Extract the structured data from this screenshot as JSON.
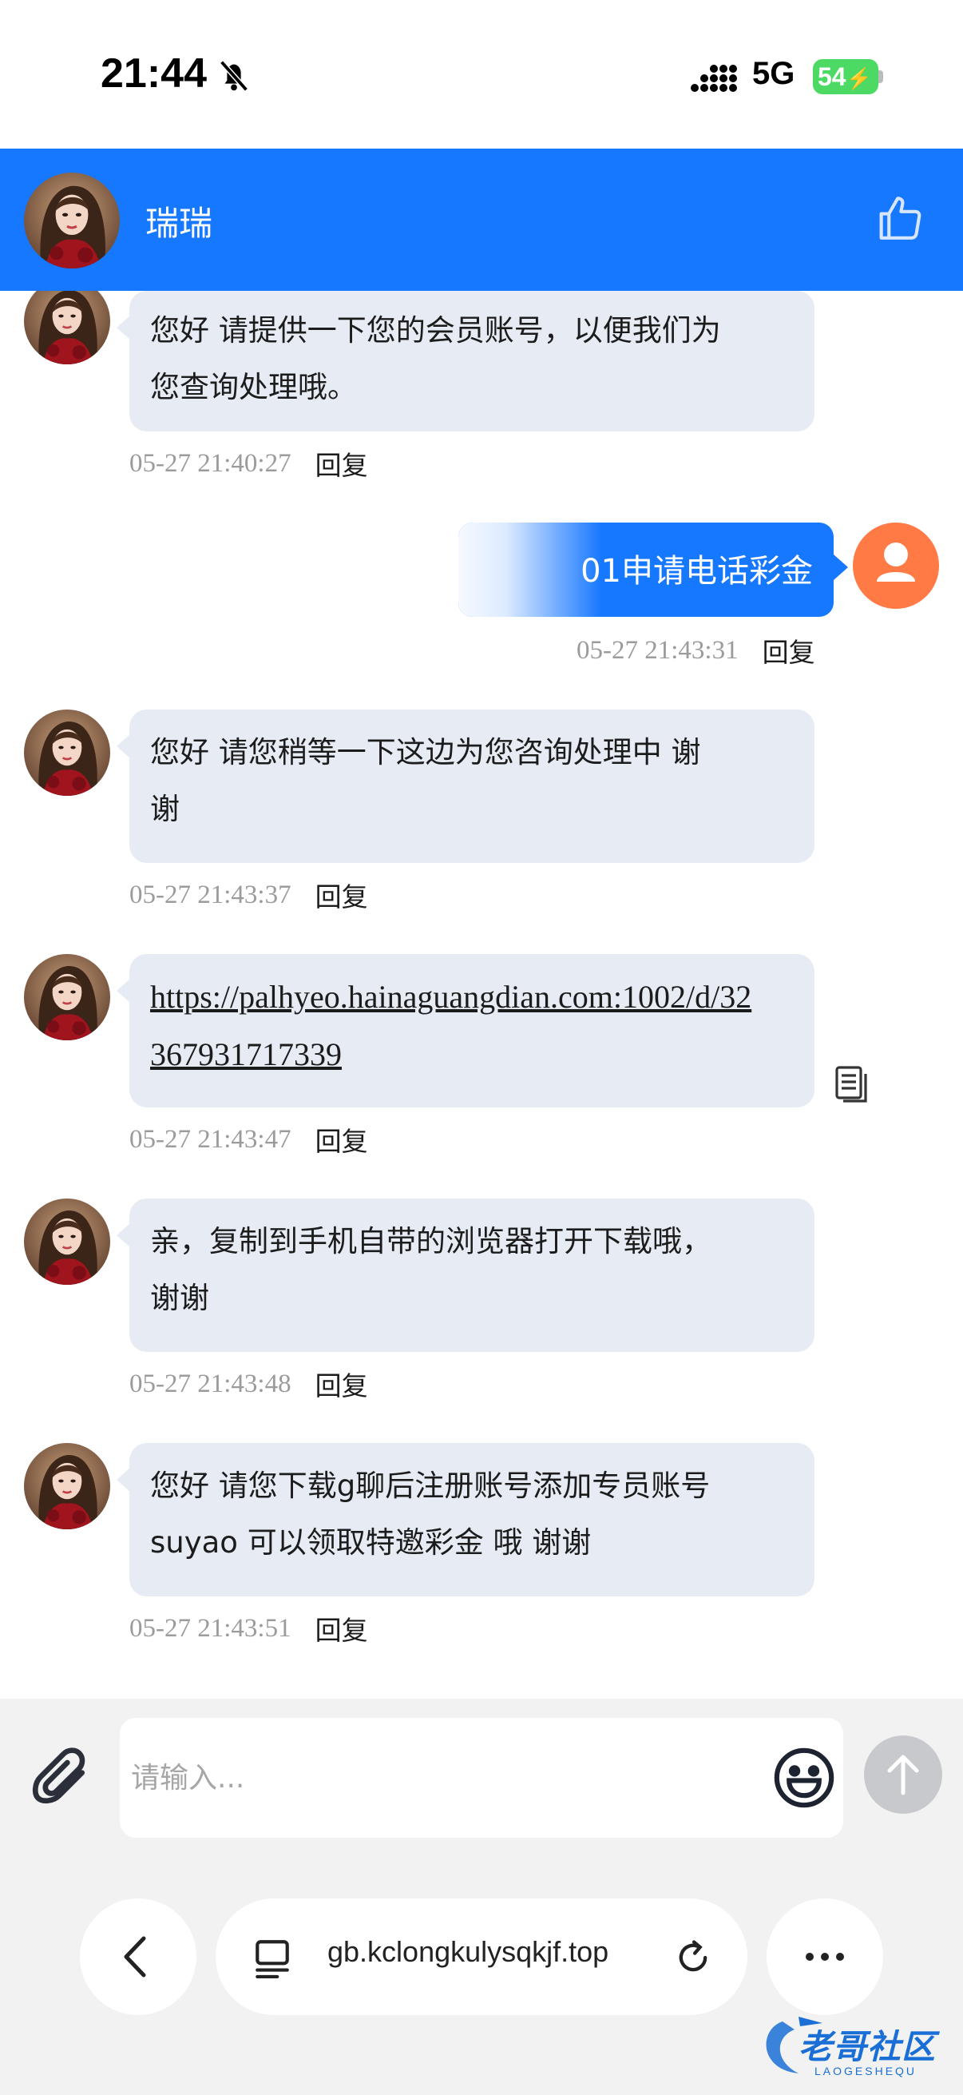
{
  "status_bar": {
    "time": "21:44",
    "network": "5G",
    "battery": "54"
  },
  "header": {
    "agent_name": "瑞瑞"
  },
  "messages": [
    {
      "side": "left",
      "text_lines": [
        "您好 请提供一下您的会员账号，以便我们为",
        "您查询处理哦。"
      ],
      "time": "05-27 21:40:27",
      "reply": "回复"
    },
    {
      "side": "right",
      "text": "01申请电话彩金",
      "time": "05-27 21:43:31",
      "reply": "回复"
    },
    {
      "side": "left",
      "text_lines": [
        "您好  请您稍等一下这边为您咨询处理中 谢",
        "谢"
      ],
      "time": "05-27 21:43:37",
      "reply": "回复"
    },
    {
      "side": "left",
      "link_lines": [
        "https://palhyeo.hainaguangdian.com:1002/d/32",
        "367931717339"
      ],
      "time": "05-27 21:43:47",
      "reply": "回复"
    },
    {
      "side": "left",
      "text_lines": [
        "亲，复制到手机自带的浏览器打开下载哦，",
        "谢谢"
      ],
      "time": "05-27 21:43:48",
      "reply": "回复"
    },
    {
      "side": "left",
      "text_lines": [
        "您好 请您下载g聊后注册账号添加专员账号",
        "suyao 可以领取特邀彩金 哦 谢谢"
      ],
      "time": "05-27 21:43:51",
      "reply": "回复"
    }
  ],
  "input": {
    "placeholder": "请输入..."
  },
  "browser": {
    "url": "gb.kclongkulysqkjf.top"
  },
  "watermark": {
    "text": "老哥社区",
    "sub": "LAOGESHEQU"
  },
  "colors": {
    "primary": "#1677ff",
    "bubble_left": "#e6ebf4",
    "user_avatar": "#ff7a45",
    "battery": "#4cd964"
  }
}
